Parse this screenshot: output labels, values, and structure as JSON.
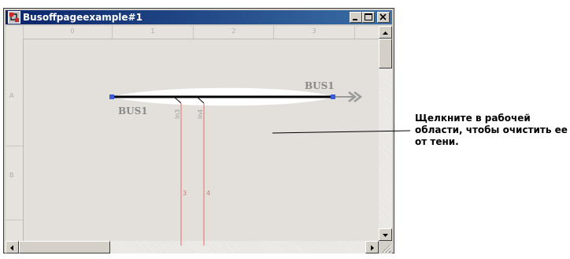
{
  "window": {
    "title": "Busoffpageexample#1",
    "buttons": [
      "minimize",
      "maximize",
      "close"
    ]
  },
  "ruler": {
    "columns": [
      "0",
      "1",
      "2",
      "3"
    ],
    "rows": [
      "A",
      "B"
    ]
  },
  "diagram": {
    "bus_label_top": "BUS1",
    "bus_label_bottom": "BUS1",
    "lines": [
      {
        "name": "ln3",
        "number": "3"
      },
      {
        "name": "ln4",
        "number": "4"
      }
    ]
  },
  "annotation": {
    "text": "Щелкните в рабочей области, чтобы очистить ее от тени."
  },
  "colors": {
    "titlebar_start": "#0a246a",
    "titlebar_end": "#3a6ea5",
    "wire": "#e0706a",
    "bus": "#000000",
    "offpage_arrow": "#9a9a9a"
  }
}
